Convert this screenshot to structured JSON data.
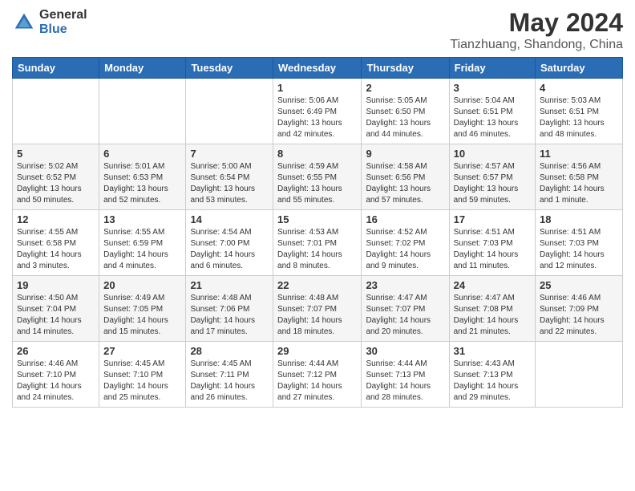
{
  "logo": {
    "general": "General",
    "blue": "Blue"
  },
  "title": "May 2024",
  "subtitle": "Tianzhuang, Shandong, China",
  "days_of_week": [
    "Sunday",
    "Monday",
    "Tuesday",
    "Wednesday",
    "Thursday",
    "Friday",
    "Saturday"
  ],
  "weeks": [
    [
      {
        "day": "",
        "info": ""
      },
      {
        "day": "",
        "info": ""
      },
      {
        "day": "",
        "info": ""
      },
      {
        "day": "1",
        "info": "Sunrise: 5:06 AM\nSunset: 6:49 PM\nDaylight: 13 hours\nand 42 minutes."
      },
      {
        "day": "2",
        "info": "Sunrise: 5:05 AM\nSunset: 6:50 PM\nDaylight: 13 hours\nand 44 minutes."
      },
      {
        "day": "3",
        "info": "Sunrise: 5:04 AM\nSunset: 6:51 PM\nDaylight: 13 hours\nand 46 minutes."
      },
      {
        "day": "4",
        "info": "Sunrise: 5:03 AM\nSunset: 6:51 PM\nDaylight: 13 hours\nand 48 minutes."
      }
    ],
    [
      {
        "day": "5",
        "info": "Sunrise: 5:02 AM\nSunset: 6:52 PM\nDaylight: 13 hours\nand 50 minutes."
      },
      {
        "day": "6",
        "info": "Sunrise: 5:01 AM\nSunset: 6:53 PM\nDaylight: 13 hours\nand 52 minutes."
      },
      {
        "day": "7",
        "info": "Sunrise: 5:00 AM\nSunset: 6:54 PM\nDaylight: 13 hours\nand 53 minutes."
      },
      {
        "day": "8",
        "info": "Sunrise: 4:59 AM\nSunset: 6:55 PM\nDaylight: 13 hours\nand 55 minutes."
      },
      {
        "day": "9",
        "info": "Sunrise: 4:58 AM\nSunset: 6:56 PM\nDaylight: 13 hours\nand 57 minutes."
      },
      {
        "day": "10",
        "info": "Sunrise: 4:57 AM\nSunset: 6:57 PM\nDaylight: 13 hours\nand 59 minutes."
      },
      {
        "day": "11",
        "info": "Sunrise: 4:56 AM\nSunset: 6:58 PM\nDaylight: 14 hours\nand 1 minute."
      }
    ],
    [
      {
        "day": "12",
        "info": "Sunrise: 4:55 AM\nSunset: 6:58 PM\nDaylight: 14 hours\nand 3 minutes."
      },
      {
        "day": "13",
        "info": "Sunrise: 4:55 AM\nSunset: 6:59 PM\nDaylight: 14 hours\nand 4 minutes."
      },
      {
        "day": "14",
        "info": "Sunrise: 4:54 AM\nSunset: 7:00 PM\nDaylight: 14 hours\nand 6 minutes."
      },
      {
        "day": "15",
        "info": "Sunrise: 4:53 AM\nSunset: 7:01 PM\nDaylight: 14 hours\nand 8 minutes."
      },
      {
        "day": "16",
        "info": "Sunrise: 4:52 AM\nSunset: 7:02 PM\nDaylight: 14 hours\nand 9 minutes."
      },
      {
        "day": "17",
        "info": "Sunrise: 4:51 AM\nSunset: 7:03 PM\nDaylight: 14 hours\nand 11 minutes."
      },
      {
        "day": "18",
        "info": "Sunrise: 4:51 AM\nSunset: 7:03 PM\nDaylight: 14 hours\nand 12 minutes."
      }
    ],
    [
      {
        "day": "19",
        "info": "Sunrise: 4:50 AM\nSunset: 7:04 PM\nDaylight: 14 hours\nand 14 minutes."
      },
      {
        "day": "20",
        "info": "Sunrise: 4:49 AM\nSunset: 7:05 PM\nDaylight: 14 hours\nand 15 minutes."
      },
      {
        "day": "21",
        "info": "Sunrise: 4:48 AM\nSunset: 7:06 PM\nDaylight: 14 hours\nand 17 minutes."
      },
      {
        "day": "22",
        "info": "Sunrise: 4:48 AM\nSunset: 7:07 PM\nDaylight: 14 hours\nand 18 minutes."
      },
      {
        "day": "23",
        "info": "Sunrise: 4:47 AM\nSunset: 7:07 PM\nDaylight: 14 hours\nand 20 minutes."
      },
      {
        "day": "24",
        "info": "Sunrise: 4:47 AM\nSunset: 7:08 PM\nDaylight: 14 hours\nand 21 minutes."
      },
      {
        "day": "25",
        "info": "Sunrise: 4:46 AM\nSunset: 7:09 PM\nDaylight: 14 hours\nand 22 minutes."
      }
    ],
    [
      {
        "day": "26",
        "info": "Sunrise: 4:46 AM\nSunset: 7:10 PM\nDaylight: 14 hours\nand 24 minutes."
      },
      {
        "day": "27",
        "info": "Sunrise: 4:45 AM\nSunset: 7:10 PM\nDaylight: 14 hours\nand 25 minutes."
      },
      {
        "day": "28",
        "info": "Sunrise: 4:45 AM\nSunset: 7:11 PM\nDaylight: 14 hours\nand 26 minutes."
      },
      {
        "day": "29",
        "info": "Sunrise: 4:44 AM\nSunset: 7:12 PM\nDaylight: 14 hours\nand 27 minutes."
      },
      {
        "day": "30",
        "info": "Sunrise: 4:44 AM\nSunset: 7:13 PM\nDaylight: 14 hours\nand 28 minutes."
      },
      {
        "day": "31",
        "info": "Sunrise: 4:43 AM\nSunset: 7:13 PM\nDaylight: 14 hours\nand 29 minutes."
      },
      {
        "day": "",
        "info": ""
      }
    ]
  ]
}
